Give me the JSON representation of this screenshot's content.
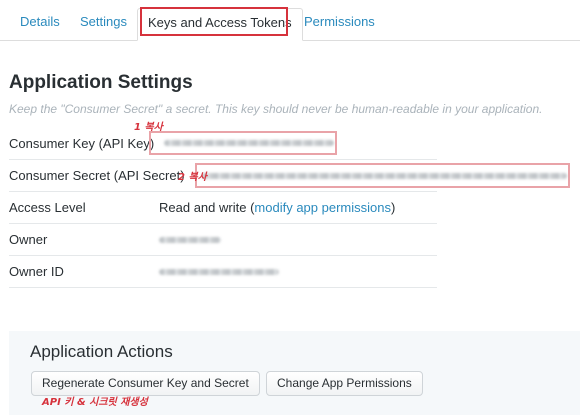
{
  "tabs": [
    {
      "label": "Details"
    },
    {
      "label": "Settings"
    },
    {
      "label": "Keys and Access Tokens"
    },
    {
      "label": "Permissions"
    }
  ],
  "settings": {
    "title": "Application Settings",
    "note": "Keep the \"Consumer Secret\" a secret. This key should never be human-readable in your application.",
    "rows": {
      "consumer_key": {
        "label": "Consumer Key (API Key)"
      },
      "consumer_secret": {
        "label": "Consumer Secret (API Secret)"
      },
      "access_level": {
        "label": "Access Level",
        "value": "Read and write",
        "open_paren": "(",
        "link": "modify app permissions",
        "close_paren": ")"
      },
      "owner": {
        "label": "Owner"
      },
      "owner_id": {
        "label": "Owner ID"
      }
    }
  },
  "annotations": {
    "key_copy": "1 복사",
    "secret_copy": "2 복사",
    "bottom_note": "API 키 & 시크릿 재생성"
  },
  "actions": {
    "title": "Application Actions",
    "regenerate_button": "Regenerate Consumer Key and Secret",
    "change_permissions_button": "Change App Permissions"
  },
  "colors": {
    "link": "#2a8abd",
    "highlight": "#d6323c",
    "panel": "#f5f8fa"
  }
}
